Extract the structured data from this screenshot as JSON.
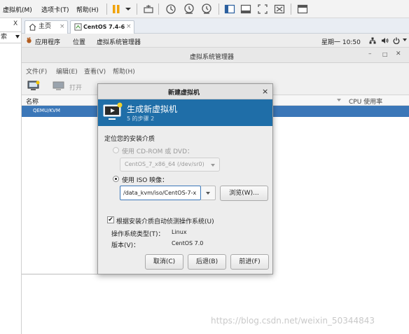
{
  "vmware": {
    "menu": [
      "虚拟机(M)",
      "选项卡(T)",
      "帮助(H)"
    ]
  },
  "library": {
    "close": "X",
    "search_fragment": "索"
  },
  "tabs": [
    {
      "label": "主页",
      "close": "×"
    },
    {
      "label": "CentOS 7.4-6",
      "close": "×"
    }
  ],
  "gnome": {
    "apps": "应用程序",
    "places": "位置",
    "app_name": "虚拟系统管理器",
    "clock": "星期一 10:50"
  },
  "vmm": {
    "title": "虚拟系统管理器",
    "menu": [
      "文件(F)",
      "编辑(E)",
      "查看(V)",
      "帮助(H)"
    ],
    "open_label": "打开",
    "col_name": "名称",
    "col_cpu": "CPU 使用率",
    "row_label": "QEMU/KVM"
  },
  "dialog": {
    "title": "新建虚拟机",
    "close": "×",
    "heading": "生成新虚拟机",
    "step": "5 的步骤 2",
    "section_label": "定位您的安装介质",
    "cdrom_label": "使用  CD-ROM 或  DVD：",
    "cdrom_value": "CentOS_7_x86_64 (/dev/sr0)",
    "iso_label": "使用  ISO 映像：",
    "iso_value": "/data_kvm/iso/CentOS-7-x",
    "browse": "浏览(W)...",
    "autodetect": "根据安装介质自动侦测操作系统(U)",
    "os_type_label": "操作系统类型(T)：",
    "os_type_value": "Linux",
    "version_label": "版本(V)：",
    "version_value": "CentOS 7.0",
    "cancel": "取消(C)",
    "back": "后退(B)",
    "forward": "前进(F)"
  },
  "watermark": "https://blog.csdn.net/weixin_50344843",
  "colors": {
    "banner": "#1f6ea8",
    "selection": "#3b77b8",
    "pause": "#f0a30a"
  }
}
